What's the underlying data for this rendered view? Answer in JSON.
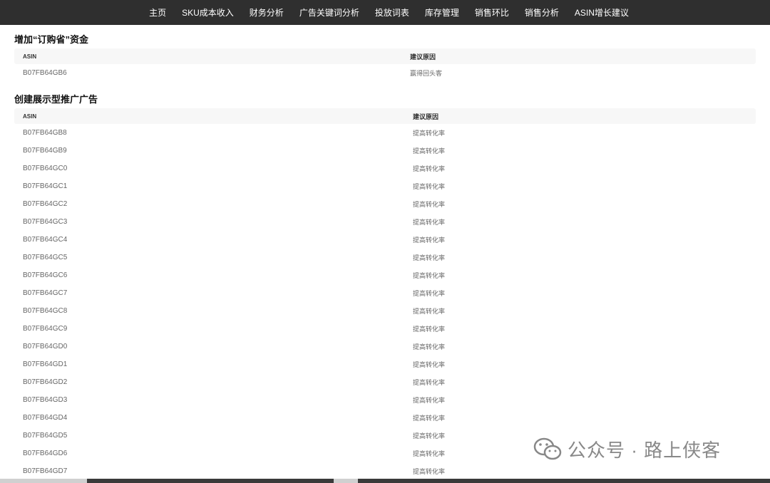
{
  "nav": {
    "items": [
      "主页",
      "SKU成本收入",
      "财务分析",
      "广告关键词分析",
      "投放词表",
      "库存管理",
      "销售环比",
      "销售分析",
      "ASIN增长建议"
    ]
  },
  "section1": {
    "title": "增加“订购省”资金",
    "headers": [
      "ASIN",
      "建议原因"
    ],
    "rows": [
      [
        "B07FB64GB6",
        "赢得回头客"
      ]
    ]
  },
  "section2": {
    "title": "创建展示型推广广告",
    "headers": [
      "ASIN",
      "建议原因"
    ],
    "rows": [
      [
        "B07FB64GB8",
        "提高转化率"
      ],
      [
        "B07FB64GB9",
        "提高转化率"
      ],
      [
        "B07FB64GC0",
        "提高转化率"
      ],
      [
        "B07FB64GC1",
        "提高转化率"
      ],
      [
        "B07FB64GC2",
        "提高转化率"
      ],
      [
        "B07FB64GC3",
        "提高转化率"
      ],
      [
        "B07FB64GC4",
        "提高转化率"
      ],
      [
        "B07FB64GC5",
        "提高转化率"
      ],
      [
        "B07FB64GC6",
        "提高转化率"
      ],
      [
        "B07FB64GC7",
        "提高转化率"
      ],
      [
        "B07FB64GC8",
        "提高转化率"
      ],
      [
        "B07FB64GC9",
        "提高转化率"
      ],
      [
        "B07FB64GD0",
        "提高转化率"
      ],
      [
        "B07FB64GD1",
        "提高转化率"
      ],
      [
        "B07FB64GD2",
        "提高转化率"
      ],
      [
        "B07FB64GD3",
        "提高转化率"
      ],
      [
        "B07FB64GD4",
        "提高转化率"
      ],
      [
        "B07FB64GD5",
        "提高转化率"
      ],
      [
        "B07FB64GD6",
        "提高转化率"
      ],
      [
        "B07FB64GD7",
        "提高转化率"
      ]
    ]
  },
  "watermark": {
    "text": "公众号 · 路上侠客",
    "icon": "wechat-icon"
  }
}
